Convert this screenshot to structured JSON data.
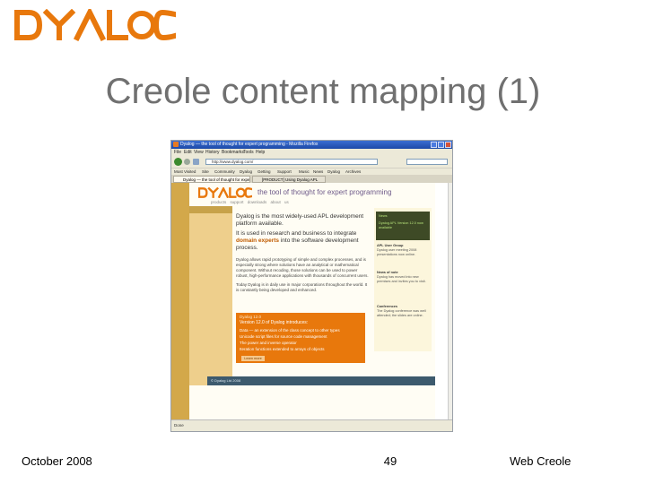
{
  "slide": {
    "brand": "DYALOC",
    "title": "Creole content mapping (1)",
    "footer_left": "October 2008",
    "page_number": "49",
    "footer_right": "Web Creole"
  },
  "browser": {
    "window_title": "Dyalog — the tool of thought for expert programming - Mozilla Firefox",
    "menu": [
      "File",
      "Edit",
      "View",
      "History",
      "Bookmarks",
      "Tools",
      "Help"
    ],
    "url": "http://www.dyalog.com/",
    "bookmarks": [
      "Most Visited",
      "Site",
      "Community",
      "Dyalog",
      "Getting",
      "Support",
      "Music",
      "News",
      "Dyalog",
      "Archives"
    ],
    "tabs": [
      "Dyalog — the tool of thought for expert...",
      "[PRODUCT] Using Dyalog APL"
    ],
    "status": "Done",
    "accent": "#1d4aa8"
  },
  "webpage": {
    "logo": "DYALOC",
    "tagline": "the tool of thought for expert programming",
    "nav": "products support downloads about us",
    "headline_1": "Dyalog is the most widely-used APL development platform available.",
    "headline_2a": "It is used in research and business to integrate",
    "headline_2b": "domain experts",
    "headline_2c": "into the software development process.",
    "body_1": "Dyalog allows rapid prototyping of simple and complex processes, and is especially strong where solutions have an analytical or mathematical component. Without recoding, those solutions can be used to power robust, high-performance applications with thousands of concurrent users.",
    "body_2": "Today Dyalog is in daily use in major corporations throughout the world. It is constantly being developed and enhanced.",
    "sidebar_news": "News",
    "sidebar_news_text": "Dyalog APL Version 12.0 now available",
    "sidebar_2_head": "APL User Group",
    "sidebar_2_text": "Dyalog user meeting 2008 presentations now online.",
    "sidebar_3_head": "News of note",
    "sidebar_3_text": "Dyalog has moved into new premises and invites you to visit.",
    "sidebar_4_head": "Conferences",
    "sidebar_4_text": "The Dyalog conference was well attended; the slides are online.",
    "panel_head": "Dyalog 12.0",
    "panel_title": "Version 12.0 of Dyalog introduces:",
    "panel_items": [
      "Data — an extension of the class concept to other types",
      "Unicode script files for source code management",
      "The power and inverse operator",
      "Iteration functions extended to arrays of objects"
    ],
    "panel_button": "Learn more",
    "footer_text": "© Dyalog Ltd 2008",
    "accent": "#e8780c"
  }
}
